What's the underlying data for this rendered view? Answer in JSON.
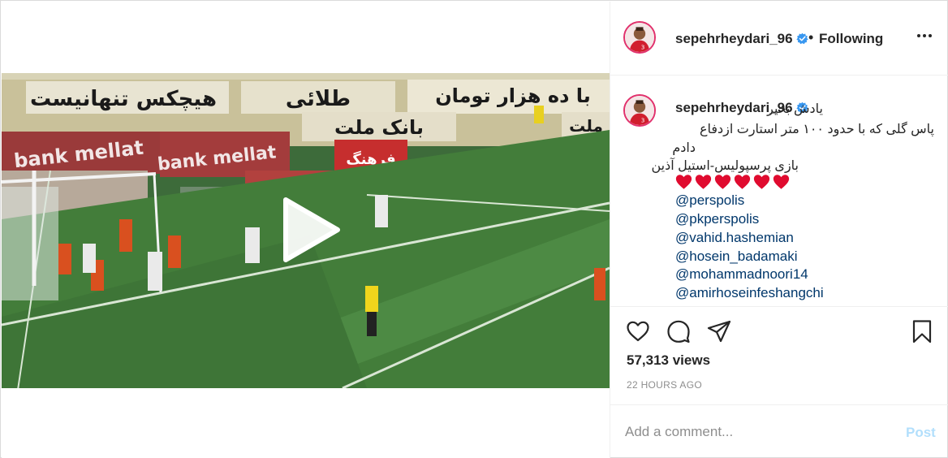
{
  "post": {
    "username": "sepehrheydari_96",
    "follow_label": "Following",
    "separator": "•",
    "caption": {
      "line1": "یادش بخیر",
      "line2": "پاس گلی که با حدود ۱۰۰ متر استارت ازدفاع",
      "line3": "دادم",
      "line4": "بازی پرسپولیس-استیل آذین",
      "heart_count": 6,
      "mentions": [
        "@perspolis",
        "@pkperspolis",
        "@vahid.hashemian",
        "@hosein_badamaki",
        "@mohammadnoori14",
        "@amirhoseinfeshangchi"
      ]
    },
    "views": "57,313 views",
    "timestamp": "22 HOURS AGO"
  },
  "comment": {
    "placeholder": "Add a comment...",
    "post_label": "Post"
  },
  "video_banners": {
    "top_left": "هیچکس تنهانیست",
    "top_mid": "طلائی",
    "top_right": "با ده هزار تومان",
    "mid": "بانک ملت",
    "right_short": "ملت",
    "sponsor": "bank mellat",
    "ad_red": "فرهنگ"
  },
  "colors": {
    "link": "#00376b",
    "verified": "#3897f0",
    "post_disabled": "#b2dffc",
    "heart": "#e00b2f",
    "muted": "#8e8e8e"
  },
  "icons": {
    "more": "more-horizontal-icon",
    "like": "heart-outline-icon",
    "comment": "comment-bubble-icon",
    "share": "paper-plane-icon",
    "save": "bookmark-icon",
    "play": "play-icon",
    "verified": "verified-badge-icon"
  }
}
